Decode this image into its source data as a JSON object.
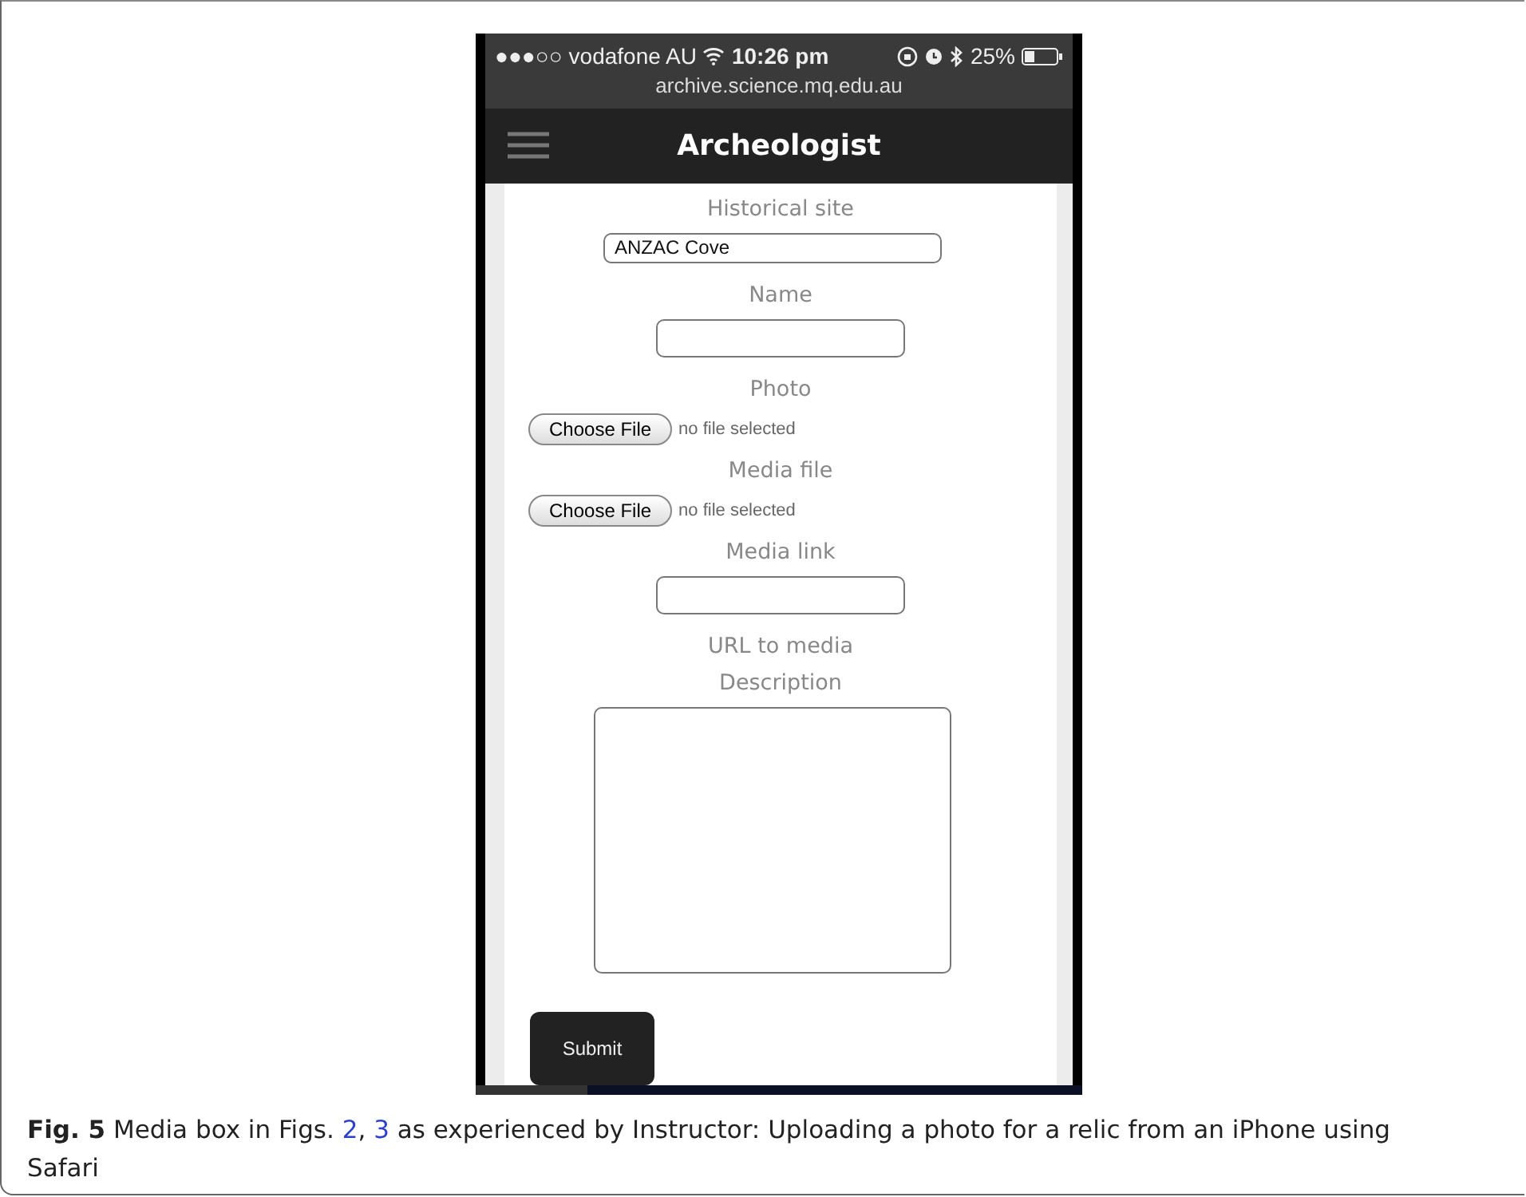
{
  "status_bar": {
    "signal": "●●●○○",
    "carrier": "vodafone AU",
    "time": "10:26 pm",
    "battery": "25%",
    "url": "archive.science.mq.edu.au"
  },
  "nav_bar": {
    "title": "Archeologist"
  },
  "form": [
    {
      "kind": "label",
      "text": "Historical site"
    },
    {
      "kind": "wide_input",
      "value": "ANZAC Cove"
    },
    {
      "kind": "label",
      "text": "Name"
    },
    {
      "kind": "input"
    },
    {
      "kind": "label",
      "text": "Photo"
    },
    {
      "kind": "file",
      "button": "Choose File",
      "status": "no file selected"
    },
    {
      "kind": "label",
      "text": "Media file"
    },
    {
      "kind": "file",
      "button": "Choose File",
      "status": "no file selected"
    },
    {
      "kind": "label",
      "text": "Media link"
    },
    {
      "kind": "input"
    },
    {
      "kind": "label",
      "text": "URL to media"
    },
    {
      "kind": "label",
      "text": "Description"
    },
    {
      "kind": "textarea"
    },
    {
      "kind": "submit",
      "text": "Submit"
    }
  ],
  "caption": [
    {
      "kind": "text",
      "text": "**Fig. 5**  Media box in Figs. "
    },
    {
      "kind": "link",
      "text": "2"
    },
    {
      "kind": "text",
      "text": ", "
    },
    {
      "kind": "link",
      "text": "3"
    },
    {
      "kind": "text",
      "text": " as experienced by Instructor: Uploading a photo for a relic from an iPhone using Safari"
    }
  ]
}
